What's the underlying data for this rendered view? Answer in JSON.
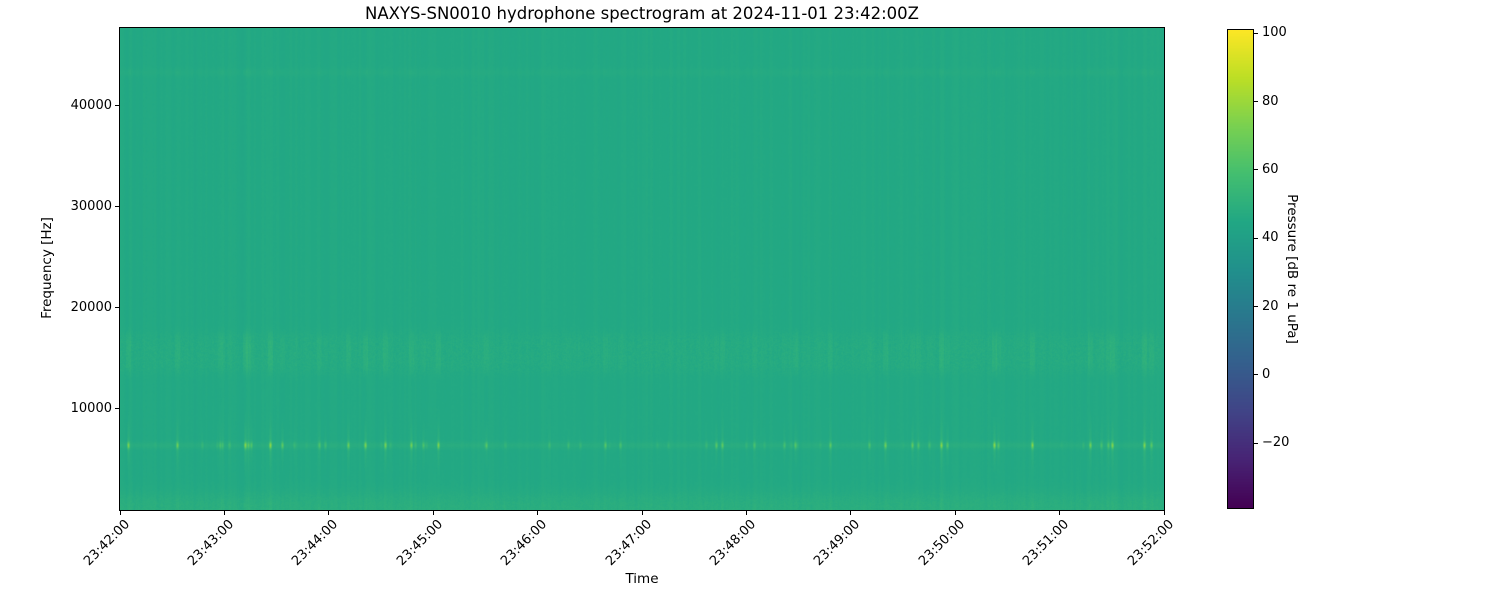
{
  "chart_data": {
    "type": "heatmap",
    "subtype": "spectrogram",
    "title": "NAXYS-SN0010 hydrophone spectrogram at 2024-11-01 23:42:00Z",
    "xlabel": "Time",
    "ylabel": "Frequency [Hz]",
    "x_tick_labels": [
      "23:42:00",
      "23:43:00",
      "23:44:00",
      "23:45:00",
      "23:46:00",
      "23:47:00",
      "23:48:00",
      "23:49:00",
      "23:50:00",
      "23:51:00",
      "23:52:00"
    ],
    "y_tick_values": [
      10000,
      20000,
      30000,
      40000
    ],
    "y_tick_labels": [
      "10000",
      "20000",
      "30000",
      "40000"
    ],
    "ylim": [
      0,
      47700
    ],
    "x_range": [
      "23:42:00",
      "23:52:00"
    ],
    "grid": false,
    "colormap": "viridis",
    "colorbar": {
      "label": "Pressure [dB re 1 uPa]",
      "tick_values": [
        100,
        80,
        60,
        40,
        20,
        0,
        -20
      ],
      "tick_labels": [
        "100",
        "80",
        "60",
        "40",
        "20",
        "0",
        "−20"
      ],
      "clim": [
        -39,
        101
      ],
      "position": "right"
    },
    "background_level_db": 45.4,
    "features": [
      {
        "kind": "tonal-line",
        "freq_hz": 6400,
        "sigma_hz": 230,
        "peak_db": 84,
        "floor_db": 48,
        "desc": "bright impulsive click train, dense yellow-green speckles"
      },
      {
        "kind": "band",
        "freq_range_hz": [
          13600,
          17400
        ],
        "peak_db": 60,
        "desc": "broadband pulsed band with vertical green striations"
      },
      {
        "kind": "band",
        "freq_range_hz": [
          0,
          1800
        ],
        "peak_db": 53,
        "desc": "brighter low-frequency strip along the bottom edge"
      },
      {
        "kind": "tonal-line",
        "freq_hz": 43300,
        "sigma_hz": 280,
        "peak_db": 49,
        "desc": "very faint high-frequency line"
      },
      {
        "kind": "striations",
        "desc": "faint full-height vertical broadband pulse streaks throughout"
      }
    ]
  }
}
